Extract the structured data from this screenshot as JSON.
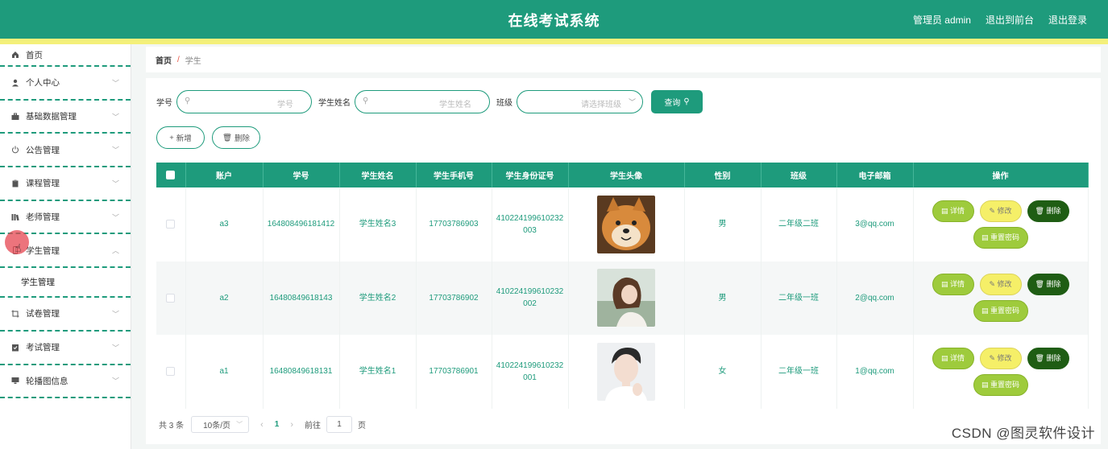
{
  "header": {
    "title": "在线考试系统",
    "admin_label": "管理员 admin",
    "front_label": "退出到前台",
    "logout_label": "退出登录"
  },
  "sidebar": {
    "items": [
      {
        "label": "首页",
        "icon": "home-icon",
        "has_chevron": false
      },
      {
        "label": "个人中心",
        "icon": "user-icon",
        "has_chevron": true
      },
      {
        "label": "基础数据管理",
        "icon": "briefcase-icon",
        "has_chevron": true
      },
      {
        "label": "公告管理",
        "icon": "power-icon",
        "has_chevron": true
      },
      {
        "label": "课程管理",
        "icon": "clipboard-icon",
        "has_chevron": true
      },
      {
        "label": "老师管理",
        "icon": "library-icon",
        "has_chevron": true
      },
      {
        "label": "学生管理",
        "icon": "mobile-icon",
        "has_chevron": true,
        "expanded": true
      },
      {
        "label": "学生管理",
        "icon": "",
        "sub": true
      },
      {
        "label": "试卷管理",
        "icon": "crop-icon",
        "has_chevron": true
      },
      {
        "label": "考试管理",
        "icon": "checklist-icon",
        "has_chevron": true
      },
      {
        "label": "轮播图信息",
        "icon": "monitor-icon",
        "has_chevron": true
      }
    ]
  },
  "breadcrumb": {
    "home": "首页",
    "separator": "/",
    "current": "学生"
  },
  "search": {
    "label_no": "学号",
    "placeholder_no": "学号",
    "label_name": "学生姓名",
    "placeholder_name": "学生姓名",
    "label_class": "班级",
    "placeholder_class": "请选择班级",
    "query_label": "查询"
  },
  "actions": {
    "add_label": "新增",
    "delete_label": "删除"
  },
  "table": {
    "headers": [
      "账户",
      "学号",
      "学生姓名",
      "学生手机号",
      "学生身份证号",
      "学生头像",
      "性别",
      "班级",
      "电子邮箱",
      "操作"
    ],
    "rows": [
      {
        "account": "a3",
        "student_no": "164808496181412",
        "name": "学生姓名3",
        "phone": "17703786903",
        "id_card": "410224199610232003",
        "avatar": "shiba-dog-photo",
        "gender": "男",
        "class": "二年级二班",
        "email": "3@qq.com"
      },
      {
        "account": "a2",
        "student_no": "16480849618143",
        "name": "学生姓名2",
        "phone": "17703786902",
        "id_card": "410224199610232002",
        "avatar": "girl-portrait-photo",
        "gender": "男",
        "class": "二年级一班",
        "email": "2@qq.com"
      },
      {
        "account": "a1",
        "student_no": "16480849618131",
        "name": "学生姓名1",
        "phone": "17703786901",
        "id_card": "410224199610232001",
        "avatar": "boy-portrait-photo",
        "gender": "女",
        "class": "二年级一班",
        "email": "1@qq.com"
      }
    ],
    "op_labels": {
      "detail": "详情",
      "edit": "修改",
      "delete": "删除",
      "reset": "重置密码"
    }
  },
  "pager": {
    "total": "共 3 条",
    "page_size": "10条/页",
    "current_page": "1",
    "goto_label": "前往",
    "goto_value": "1",
    "page_unit": "页"
  },
  "watermark": "CSDN @图灵软件设计",
  "colors": {
    "primary": "#1e9b7c",
    "accent_yellow": "#f4f07a",
    "detail_green": "#9ecb3c",
    "edit_yellow": "#f5ef68",
    "delete_dark": "#1f5d14"
  }
}
